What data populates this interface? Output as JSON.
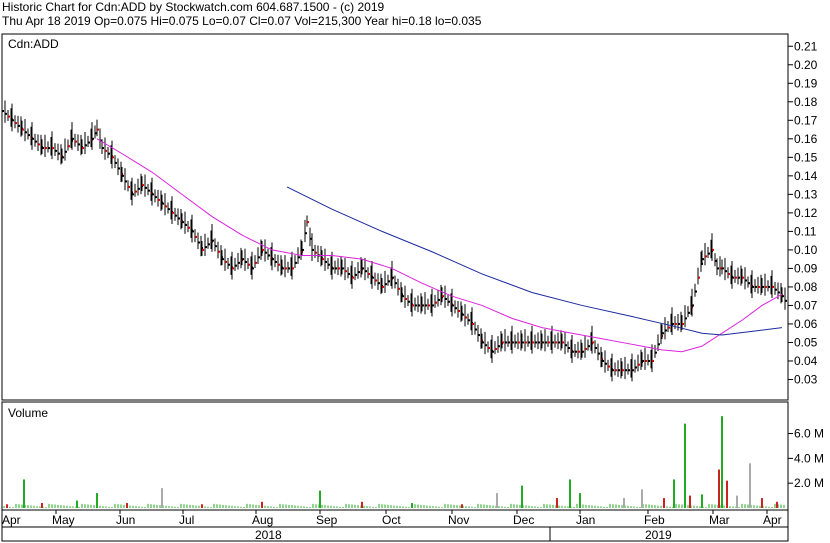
{
  "header": {
    "line1": "Historic Chart for Cdn:ADD by Stockwatch.com 604.687.1500 - (c) 2019",
    "line2": "Thu Apr 18 2019   Op=0.075   Hi=0.075   Lo=0.07   Cl=0.07   Vol=215,300   Year hi=0.18   lo=0.035"
  },
  "colors": {
    "up_bar": "#000000",
    "down_bar": "#cc0000",
    "ma_short": "#dd22dd",
    "ma_long": "#1a2aa0",
    "vol_up": "#22aa22",
    "vol_down": "#cc2222",
    "vol_flat": "#aaaaaa"
  },
  "chart_data": [
    {
      "type": "ohlc",
      "title": "Cdn:ADD",
      "ylim": [
        0.02,
        0.215
      ],
      "y_ticks": [
        "0.21",
        "0.20",
        "0.19",
        "0.18",
        "0.17",
        "0.16",
        "0.15",
        "0.14",
        "0.13",
        "0.12",
        "0.11",
        "0.10",
        "0.09",
        "0.08",
        "0.07",
        "0.06",
        "0.05",
        "0.04",
        "0.03"
      ],
      "x_labels": [
        "Apr",
        "May",
        "Jun",
        "Jul",
        "Aug",
        "Sep",
        "Oct",
        "Nov",
        "Dec",
        "Jan",
        "Feb",
        "Mar",
        "Apr"
      ],
      "years": [
        "2018",
        "2019"
      ],
      "series": [
        {
          "name": "price_points",
          "x": [
            0,
            10,
            20,
            30,
            40,
            50,
            60,
            70,
            80,
            90,
            95,
            100,
            110,
            120,
            130,
            140,
            150,
            160,
            170,
            180,
            190,
            200,
            210,
            220,
            230,
            240,
            250,
            260,
            270,
            280,
            290,
            300,
            305,
            310,
            320,
            330,
            340,
            350,
            360,
            370,
            380,
            390,
            400,
            410,
            420,
            430,
            440,
            450,
            460,
            470,
            480,
            490,
            500,
            510,
            520,
            530,
            540,
            550,
            560,
            570,
            580,
            590,
            600,
            610,
            620,
            630,
            640,
            650,
            660,
            670,
            680,
            690,
            700,
            710,
            715,
            720,
            730,
            740,
            750,
            760,
            770,
            780,
            786
          ],
          "values": [
            0.175,
            0.17,
            0.165,
            0.16,
            0.155,
            0.155,
            0.15,
            0.16,
            0.155,
            0.16,
            0.165,
            0.155,
            0.15,
            0.14,
            0.13,
            0.135,
            0.13,
            0.125,
            0.12,
            0.115,
            0.11,
            0.1,
            0.105,
            0.095,
            0.09,
            0.095,
            0.09,
            0.1,
            0.095,
            0.09,
            0.09,
            0.1,
            0.115,
            0.1,
            0.095,
            0.09,
            0.09,
            0.085,
            0.09,
            0.085,
            0.08,
            0.085,
            0.075,
            0.07,
            0.07,
            0.07,
            0.075,
            0.07,
            0.065,
            0.06,
            0.05,
            0.045,
            0.05,
            0.05,
            0.05,
            0.05,
            0.05,
            0.05,
            0.05,
            0.045,
            0.045,
            0.05,
            0.04,
            0.035,
            0.035,
            0.035,
            0.04,
            0.04,
            0.055,
            0.06,
            0.06,
            0.07,
            0.095,
            0.1,
            0.09,
            0.09,
            0.085,
            0.085,
            0.08,
            0.08,
            0.08,
            0.075,
            0.07
          ]
        }
      ],
      "moving_averages": [
        {
          "name": "short",
          "x": [
            95,
            120,
            150,
            180,
            210,
            240,
            270,
            300,
            330,
            360,
            390,
            420,
            450,
            480,
            510,
            540,
            570,
            600,
            630,
            660,
            680,
            700,
            720,
            740,
            760,
            780
          ],
          "values": [
            0.16,
            0.152,
            0.142,
            0.13,
            0.118,
            0.108,
            0.1,
            0.097,
            0.097,
            0.095,
            0.09,
            0.082,
            0.075,
            0.07,
            0.063,
            0.058,
            0.055,
            0.052,
            0.049,
            0.046,
            0.045,
            0.048,
            0.055,
            0.062,
            0.07,
            0.076
          ]
        },
        {
          "name": "long",
          "x": [
            285,
            330,
            380,
            430,
            480,
            530,
            580,
            630,
            670,
            700,
            720,
            750,
            780
          ],
          "values": [
            0.134,
            0.122,
            0.11,
            0.099,
            0.087,
            0.077,
            0.07,
            0.064,
            0.059,
            0.055,
            0.054,
            0.056,
            0.058
          ]
        }
      ]
    },
    {
      "type": "bar",
      "title": "Volume",
      "ylim": [
        0,
        8.3
      ],
      "y_ticks": [
        "6.0 M",
        "4.0 M",
        "2.0 M"
      ],
      "bars": [
        {
          "x": 5,
          "v": 0.3,
          "c": "down"
        },
        {
          "x": 22,
          "v": 2.3,
          "c": "up"
        },
        {
          "x": 40,
          "v": 0.4,
          "c": "down"
        },
        {
          "x": 75,
          "v": 0.6,
          "c": "up"
        },
        {
          "x": 95,
          "v": 1.2,
          "c": "up"
        },
        {
          "x": 125,
          "v": 0.4,
          "c": "down"
        },
        {
          "x": 160,
          "v": 1.6,
          "c": "flat"
        },
        {
          "x": 200,
          "v": 0.3,
          "c": "down"
        },
        {
          "x": 260,
          "v": 0.5,
          "c": "down"
        },
        {
          "x": 318,
          "v": 1.4,
          "c": "up"
        },
        {
          "x": 360,
          "v": 0.5,
          "c": "down"
        },
        {
          "x": 410,
          "v": 0.4,
          "c": "up"
        },
        {
          "x": 460,
          "v": 0.3,
          "c": "down"
        },
        {
          "x": 495,
          "v": 1.2,
          "c": "flat"
        },
        {
          "x": 520,
          "v": 1.8,
          "c": "up"
        },
        {
          "x": 555,
          "v": 0.8,
          "c": "down"
        },
        {
          "x": 568,
          "v": 2.3,
          "c": "up"
        },
        {
          "x": 578,
          "v": 1.2,
          "c": "up"
        },
        {
          "x": 622,
          "v": 0.8,
          "c": "flat"
        },
        {
          "x": 640,
          "v": 1.5,
          "c": "flat"
        },
        {
          "x": 662,
          "v": 0.8,
          "c": "down"
        },
        {
          "x": 672,
          "v": 2.3,
          "c": "up"
        },
        {
          "x": 683,
          "v": 6.8,
          "c": "up"
        },
        {
          "x": 688,
          "v": 1.0,
          "c": "down"
        },
        {
          "x": 700,
          "v": 1.1,
          "c": "up"
        },
        {
          "x": 717,
          "v": 3.1,
          "c": "down"
        },
        {
          "x": 720,
          "v": 7.4,
          "c": "up"
        },
        {
          "x": 725,
          "v": 2.2,
          "c": "down"
        },
        {
          "x": 735,
          "v": 1.0,
          "c": "flat"
        },
        {
          "x": 748,
          "v": 3.6,
          "c": "flat"
        },
        {
          "x": 760,
          "v": 0.8,
          "c": "down"
        },
        {
          "x": 775,
          "v": 0.5,
          "c": "down"
        }
      ]
    }
  ]
}
